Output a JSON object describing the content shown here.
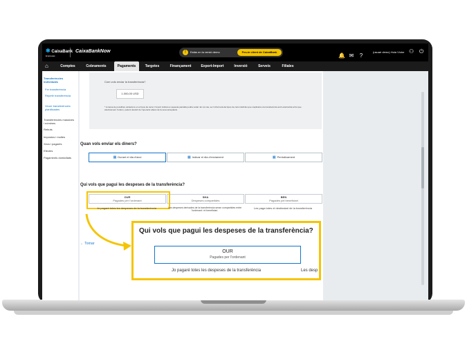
{
  "header": {
    "logo_text": "CaixaBank",
    "logo_sub": "Empresas",
    "brand": "CaixaBankNow",
    "notice": "Estàs en la versió demo",
    "cta": "Fes-te client de CaixaBank",
    "user": "(usuari demo) Hola Víctor"
  },
  "nav": {
    "items": [
      "Comptes",
      "Cobraments",
      "Pagaments",
      "Targetes",
      "Finançament",
      "Export-Import",
      "Inversió",
      "Serveis",
      "Filiales"
    ],
    "active": "Pagaments"
  },
  "sidebar": {
    "items": [
      {
        "label": "Transferències individuals"
      },
      {
        "label": "Fer transferència"
      },
      {
        "label": "Repetir transferència"
      },
      {
        "label": "Veure transferències planificades"
      },
      {
        "label": "Transferències massives i nòmines"
      },
      {
        "label": "Rebuts"
      },
      {
        "label": "Impostos i multes"
      },
      {
        "label": "Xecs i pagarés"
      },
      {
        "label": "Efectes"
      },
      {
        "label": "Pagaments domiciliats"
      }
    ]
  },
  "form": {
    "send_label": "Com vols enviar la transferència?",
    "amount": "1.000,00 USD",
    "note": "* A causa de possibles variacions en el tipus de canvi, l'import indicat en aquesta pantalla podria variar. En tot cas, se li informarà del tipus de canvi definitiu que s'aplicarà a la transferència amb anterioritat al fet que efectivament l'ordeni, podent desistir de l'operació abans de la seva acceptació.",
    "when_title": "Quan vols enviar els diners?",
    "when_options": [
      "Durant el dia d'avui",
      "Indicar el dia d'enviament",
      "Periòdicament"
    ],
    "fees_title": "Qui vols que pagui les despeses de la transferència?",
    "fees_options": [
      {
        "title": "OUR",
        "subtitle": "Pagades per l'ordenant",
        "desc": "Jo pagaré totes les despeses de la transferència"
      },
      {
        "title": "SHA",
        "subtitle": "Despeses compartides",
        "desc": "Les despeses derivades de la transferència seran compartides entre l'ordenant i el beneficiari."
      },
      {
        "title": "BEN",
        "subtitle": "Pagades pel beneficiari",
        "desc": "Les paga totes el destinatari de la transferència"
      }
    ],
    "back": "← Tornar"
  },
  "zoom": {
    "title": "Qui vols que pagui les despeses de la transferència?",
    "option_title": "OUR",
    "option_subtitle": "Pagades per l'ordenant",
    "desc": "Jo pagaré totes les despeses de la transferència",
    "desc_cut": "Les desp"
  },
  "colors": {
    "accent": "#f5c400",
    "link": "#1273c9",
    "topbar": "#000000"
  }
}
